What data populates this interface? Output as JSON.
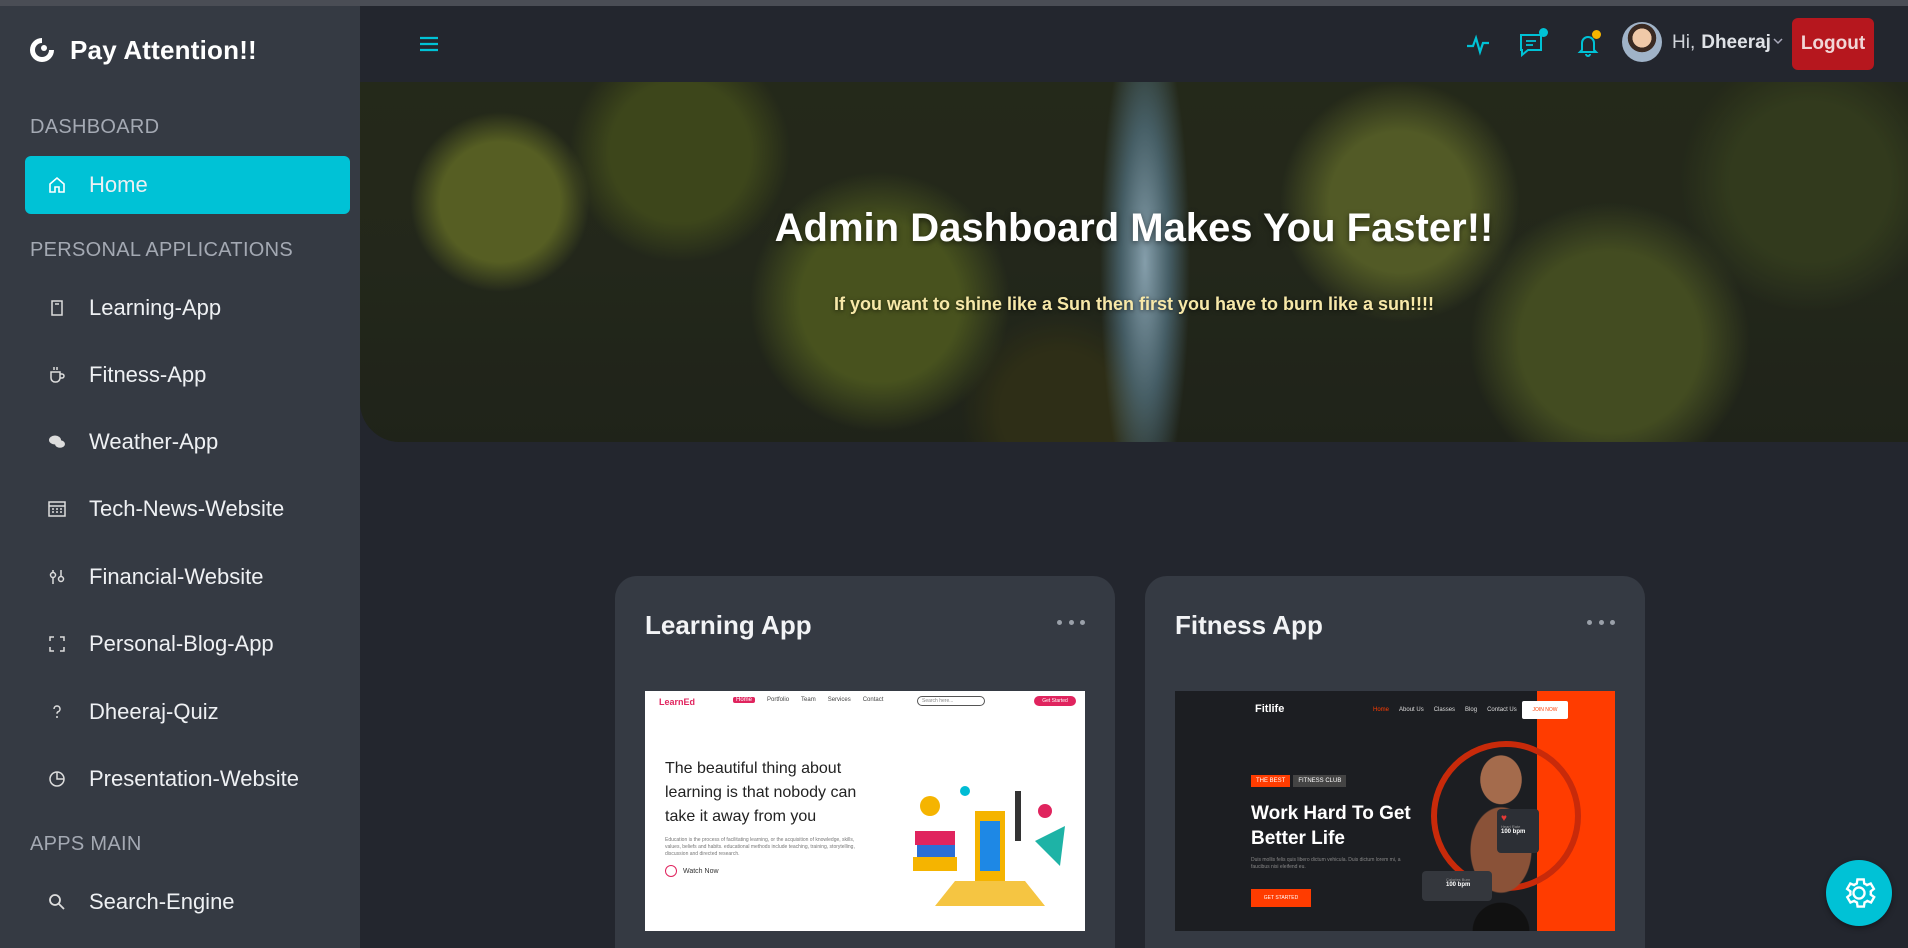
{
  "brand": {
    "name": "Pay Attention!!"
  },
  "sidebar": {
    "sections": [
      {
        "title": "DASHBOARD"
      },
      {
        "title": "PERSONAL APPLICATIONS"
      },
      {
        "title": "APPS MAIN"
      }
    ],
    "items": [
      {
        "label": "Home",
        "icon": "home-icon",
        "active": true
      },
      {
        "label": "Learning-App",
        "icon": "book-icon"
      },
      {
        "label": "Fitness-App",
        "icon": "cup-icon"
      },
      {
        "label": "Weather-App",
        "icon": "chat-bubbles-icon"
      },
      {
        "label": "Tech-News-Website",
        "icon": "calculator-icon"
      },
      {
        "label": "Financial-Website",
        "icon": "sliders-icon"
      },
      {
        "label": "Personal-Blog-App",
        "icon": "expand-icon"
      },
      {
        "label": "Dheeraj-Quiz",
        "icon": "question-icon"
      },
      {
        "label": "Presentation-Website",
        "icon": "pie-chart-icon"
      },
      {
        "label": "Search-Engine",
        "icon": "search-icon"
      }
    ]
  },
  "topbar": {
    "greeting": "Hi,",
    "username": "Dheeraj",
    "logout_label": "Logout",
    "accent": "#00c2d6",
    "dot_colors": [
      "#00c2d6",
      "#f4b400"
    ]
  },
  "hero": {
    "title": "Admin Dashboard Makes You Faster!!",
    "subtitle": "If you want to shine like a Sun then first you have to burn like a sun!!!!"
  },
  "cards": [
    {
      "title": "Learning App",
      "preview": {
        "logo": "LearnEd",
        "nav": [
          "Home",
          "Portfolio",
          "Team",
          "Services",
          "Contact"
        ],
        "search_placeholder": "Search here...",
        "cta": "Get Started",
        "headline": "The beautiful thing about learning is that nobody can take it away from you",
        "body": "Education is the process of facilitating learning, or the acquisition of knowledge, skills, values, beliefs and habits. educational methods include teaching, training, storytelling, discussion and directed research.",
        "watch": "Watch Now"
      }
    },
    {
      "title": "Fitness App",
      "preview": {
        "logo": "Fitlife",
        "nav": [
          "Home",
          "About Us",
          "Classes",
          "Blog",
          "Contact Us"
        ],
        "join": "JOIN NOW",
        "tags": [
          "THE BEST",
          "FITNESS CLUB"
        ],
        "headline": "Work Hard To Get Better Life",
        "body": "Duis mollis felis quis libero dictum vehicula. Duis dictum lorem mi, a faucibus nisi eleifend eu.",
        "start": "GET STARTED",
        "stat1_label": "Heart Rate",
        "stat1_value": "100 bpm",
        "stat2_label": "Calories Burn",
        "stat2_value": "100 bpm"
      }
    }
  ]
}
